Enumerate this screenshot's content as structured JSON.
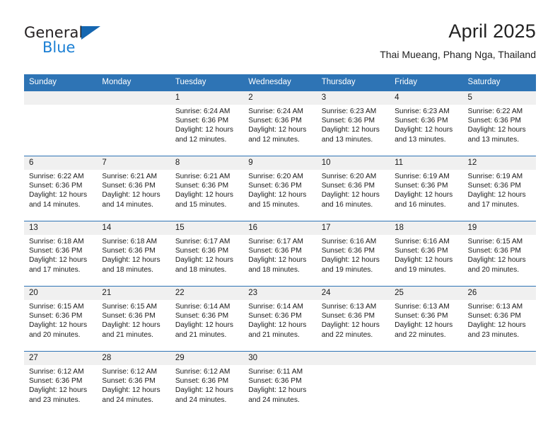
{
  "brand": {
    "name_part1": "General",
    "name_part2": "Blue",
    "triangle_icon": "triangle-icon",
    "accent_color": "#1b7fd4"
  },
  "header": {
    "month_title": "April 2025",
    "location": "Thai Mueang, Phang Nga, Thailand"
  },
  "calendar": {
    "header_color": "#2e74b5",
    "band_color": "#f0f0f0",
    "weekday_headers": [
      "Sunday",
      "Monday",
      "Tuesday",
      "Wednesday",
      "Thursday",
      "Friday",
      "Saturday"
    ],
    "weeks": [
      [
        {
          "day": "",
          "sunrise": "",
          "sunset": "",
          "daylight1": "",
          "daylight2": "",
          "empty": true
        },
        {
          "day": "",
          "sunrise": "",
          "sunset": "",
          "daylight1": "",
          "daylight2": "",
          "empty": true
        },
        {
          "day": "1",
          "sunrise": "Sunrise: 6:24 AM",
          "sunset": "Sunset: 6:36 PM",
          "daylight1": "Daylight: 12 hours",
          "daylight2": "and 12 minutes.",
          "empty": false
        },
        {
          "day": "2",
          "sunrise": "Sunrise: 6:24 AM",
          "sunset": "Sunset: 6:36 PM",
          "daylight1": "Daylight: 12 hours",
          "daylight2": "and 12 minutes.",
          "empty": false
        },
        {
          "day": "3",
          "sunrise": "Sunrise: 6:23 AM",
          "sunset": "Sunset: 6:36 PM",
          "daylight1": "Daylight: 12 hours",
          "daylight2": "and 13 minutes.",
          "empty": false
        },
        {
          "day": "4",
          "sunrise": "Sunrise: 6:23 AM",
          "sunset": "Sunset: 6:36 PM",
          "daylight1": "Daylight: 12 hours",
          "daylight2": "and 13 minutes.",
          "empty": false
        },
        {
          "day": "5",
          "sunrise": "Sunrise: 6:22 AM",
          "sunset": "Sunset: 6:36 PM",
          "daylight1": "Daylight: 12 hours",
          "daylight2": "and 13 minutes.",
          "empty": false
        }
      ],
      [
        {
          "day": "6",
          "sunrise": "Sunrise: 6:22 AM",
          "sunset": "Sunset: 6:36 PM",
          "daylight1": "Daylight: 12 hours",
          "daylight2": "and 14 minutes.",
          "empty": false
        },
        {
          "day": "7",
          "sunrise": "Sunrise: 6:21 AM",
          "sunset": "Sunset: 6:36 PM",
          "daylight1": "Daylight: 12 hours",
          "daylight2": "and 14 minutes.",
          "empty": false
        },
        {
          "day": "8",
          "sunrise": "Sunrise: 6:21 AM",
          "sunset": "Sunset: 6:36 PM",
          "daylight1": "Daylight: 12 hours",
          "daylight2": "and 15 minutes.",
          "empty": false
        },
        {
          "day": "9",
          "sunrise": "Sunrise: 6:20 AM",
          "sunset": "Sunset: 6:36 PM",
          "daylight1": "Daylight: 12 hours",
          "daylight2": "and 15 minutes.",
          "empty": false
        },
        {
          "day": "10",
          "sunrise": "Sunrise: 6:20 AM",
          "sunset": "Sunset: 6:36 PM",
          "daylight1": "Daylight: 12 hours",
          "daylight2": "and 16 minutes.",
          "empty": false
        },
        {
          "day": "11",
          "sunrise": "Sunrise: 6:19 AM",
          "sunset": "Sunset: 6:36 PM",
          "daylight1": "Daylight: 12 hours",
          "daylight2": "and 16 minutes.",
          "empty": false
        },
        {
          "day": "12",
          "sunrise": "Sunrise: 6:19 AM",
          "sunset": "Sunset: 6:36 PM",
          "daylight1": "Daylight: 12 hours",
          "daylight2": "and 17 minutes.",
          "empty": false
        }
      ],
      [
        {
          "day": "13",
          "sunrise": "Sunrise: 6:18 AM",
          "sunset": "Sunset: 6:36 PM",
          "daylight1": "Daylight: 12 hours",
          "daylight2": "and 17 minutes.",
          "empty": false
        },
        {
          "day": "14",
          "sunrise": "Sunrise: 6:18 AM",
          "sunset": "Sunset: 6:36 PM",
          "daylight1": "Daylight: 12 hours",
          "daylight2": "and 18 minutes.",
          "empty": false
        },
        {
          "day": "15",
          "sunrise": "Sunrise: 6:17 AM",
          "sunset": "Sunset: 6:36 PM",
          "daylight1": "Daylight: 12 hours",
          "daylight2": "and 18 minutes.",
          "empty": false
        },
        {
          "day": "16",
          "sunrise": "Sunrise: 6:17 AM",
          "sunset": "Sunset: 6:36 PM",
          "daylight1": "Daylight: 12 hours",
          "daylight2": "and 18 minutes.",
          "empty": false
        },
        {
          "day": "17",
          "sunrise": "Sunrise: 6:16 AM",
          "sunset": "Sunset: 6:36 PM",
          "daylight1": "Daylight: 12 hours",
          "daylight2": "and 19 minutes.",
          "empty": false
        },
        {
          "day": "18",
          "sunrise": "Sunrise: 6:16 AM",
          "sunset": "Sunset: 6:36 PM",
          "daylight1": "Daylight: 12 hours",
          "daylight2": "and 19 minutes.",
          "empty": false
        },
        {
          "day": "19",
          "sunrise": "Sunrise: 6:15 AM",
          "sunset": "Sunset: 6:36 PM",
          "daylight1": "Daylight: 12 hours",
          "daylight2": "and 20 minutes.",
          "empty": false
        }
      ],
      [
        {
          "day": "20",
          "sunrise": "Sunrise: 6:15 AM",
          "sunset": "Sunset: 6:36 PM",
          "daylight1": "Daylight: 12 hours",
          "daylight2": "and 20 minutes.",
          "empty": false
        },
        {
          "day": "21",
          "sunrise": "Sunrise: 6:15 AM",
          "sunset": "Sunset: 6:36 PM",
          "daylight1": "Daylight: 12 hours",
          "daylight2": "and 21 minutes.",
          "empty": false
        },
        {
          "day": "22",
          "sunrise": "Sunrise: 6:14 AM",
          "sunset": "Sunset: 6:36 PM",
          "daylight1": "Daylight: 12 hours",
          "daylight2": "and 21 minutes.",
          "empty": false
        },
        {
          "day": "23",
          "sunrise": "Sunrise: 6:14 AM",
          "sunset": "Sunset: 6:36 PM",
          "daylight1": "Daylight: 12 hours",
          "daylight2": "and 21 minutes.",
          "empty": false
        },
        {
          "day": "24",
          "sunrise": "Sunrise: 6:13 AM",
          "sunset": "Sunset: 6:36 PM",
          "daylight1": "Daylight: 12 hours",
          "daylight2": "and 22 minutes.",
          "empty": false
        },
        {
          "day": "25",
          "sunrise": "Sunrise: 6:13 AM",
          "sunset": "Sunset: 6:36 PM",
          "daylight1": "Daylight: 12 hours",
          "daylight2": "and 22 minutes.",
          "empty": false
        },
        {
          "day": "26",
          "sunrise": "Sunrise: 6:13 AM",
          "sunset": "Sunset: 6:36 PM",
          "daylight1": "Daylight: 12 hours",
          "daylight2": "and 23 minutes.",
          "empty": false
        }
      ],
      [
        {
          "day": "27",
          "sunrise": "Sunrise: 6:12 AM",
          "sunset": "Sunset: 6:36 PM",
          "daylight1": "Daylight: 12 hours",
          "daylight2": "and 23 minutes.",
          "empty": false
        },
        {
          "day": "28",
          "sunrise": "Sunrise: 6:12 AM",
          "sunset": "Sunset: 6:36 PM",
          "daylight1": "Daylight: 12 hours",
          "daylight2": "and 24 minutes.",
          "empty": false
        },
        {
          "day": "29",
          "sunrise": "Sunrise: 6:12 AM",
          "sunset": "Sunset: 6:36 PM",
          "daylight1": "Daylight: 12 hours",
          "daylight2": "and 24 minutes.",
          "empty": false
        },
        {
          "day": "30",
          "sunrise": "Sunrise: 6:11 AM",
          "sunset": "Sunset: 6:36 PM",
          "daylight1": "Daylight: 12 hours",
          "daylight2": "and 24 minutes.",
          "empty": false
        },
        {
          "day": "",
          "sunrise": "",
          "sunset": "",
          "daylight1": "",
          "daylight2": "",
          "empty": true
        },
        {
          "day": "",
          "sunrise": "",
          "sunset": "",
          "daylight1": "",
          "daylight2": "",
          "empty": true
        },
        {
          "day": "",
          "sunrise": "",
          "sunset": "",
          "daylight1": "",
          "daylight2": "",
          "empty": true
        }
      ]
    ]
  }
}
